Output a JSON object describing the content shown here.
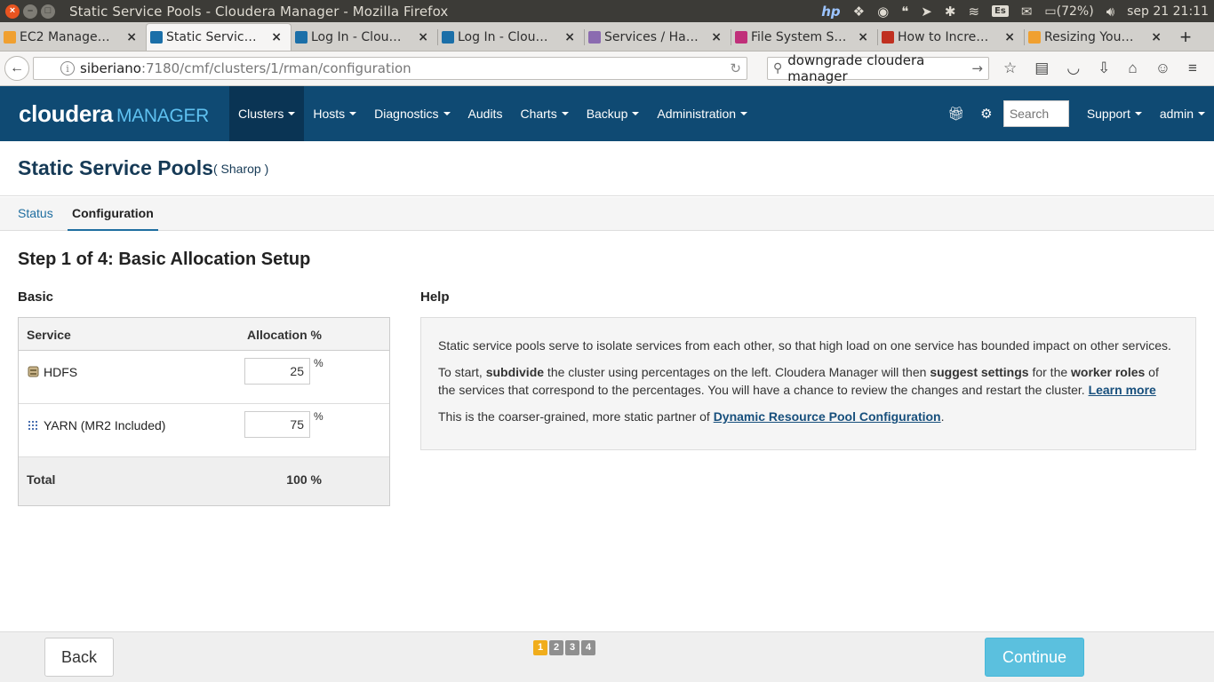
{
  "os": {
    "window_title": "Static Service Pools - Cloudera Manager - Mozilla Firefox",
    "battery": "(72%)",
    "keyboard_layout": "Es",
    "clock": "sep 21 21:11"
  },
  "browser": {
    "tabs": [
      {
        "label": "EC2 Manage…",
        "icon_color": "#f0a030",
        "active": false
      },
      {
        "label": "Static Servic…",
        "icon_color": "#1b6fa8",
        "active": true
      },
      {
        "label": "Log In - Clou…",
        "icon_color": "#1b6fa8",
        "active": false
      },
      {
        "label": "Log In - Clou…",
        "icon_color": "#1b6fa8",
        "active": false
      },
      {
        "label": "Services / Ha…",
        "icon_color": "#8b6bb0",
        "active": false
      },
      {
        "label": "File System S…",
        "icon_color": "#c0307a",
        "active": false
      },
      {
        "label": "How to Incre…",
        "icon_color": "#c03020",
        "active": false
      },
      {
        "label": "Resizing You…",
        "icon_color": "#f0a030",
        "active": false
      }
    ],
    "url_host": "siberiano",
    "url_rest": ":7180/cmf/clusters/1/rman/configuration",
    "search_value": "downgrade cloudera manager"
  },
  "header": {
    "logo_main": "cloudera",
    "logo_sub": "MANAGER",
    "nav": [
      {
        "label": "Clusters",
        "dropdown": true,
        "active": true
      },
      {
        "label": "Hosts",
        "dropdown": true,
        "active": false
      },
      {
        "label": "Diagnostics",
        "dropdown": true,
        "active": false
      },
      {
        "label": "Audits",
        "dropdown": false,
        "active": false
      },
      {
        "label": "Charts",
        "dropdown": true,
        "active": false
      },
      {
        "label": "Backup",
        "dropdown": true,
        "active": false
      },
      {
        "label": "Administration",
        "dropdown": true,
        "active": false
      }
    ],
    "search_placeholder": "Search",
    "support_label": "Support",
    "user_label": "admin"
  },
  "page": {
    "title": "Static Service Pools",
    "cluster": "( Sharop )",
    "tabs": [
      {
        "label": "Status",
        "active": false
      },
      {
        "label": "Configuration",
        "active": true
      }
    ],
    "step_title": "Step 1 of 4: Basic Allocation Setup"
  },
  "basic": {
    "heading": "Basic",
    "col_service": "Service",
    "col_allocation": "Allocation %",
    "rows": [
      {
        "service": "HDFS",
        "value": "25",
        "unit": "%"
      },
      {
        "service": "YARN (MR2 Included)",
        "value": "75",
        "unit": "%"
      }
    ],
    "total_label": "Total",
    "total_value": "100 %"
  },
  "help": {
    "heading": "Help",
    "p1": "Static service pools serve to isolate services from each other, so that high load on one service has bounded impact on other services.",
    "p2_a": "To start, ",
    "p2_b": "subdivide",
    "p2_c": " the cluster using percentages on the left. Cloudera Manager will then ",
    "p2_d": "suggest settings",
    "p2_e": " for the ",
    "p2_f": "worker roles",
    "p2_g": " of the services that correspond to the percentages. You will have a chance to review the changes and restart the cluster. ",
    "p2_link": "Learn more",
    "p3_a": "This is the coarser-grained, more static partner of ",
    "p3_link": "Dynamic Resource Pool Configuration",
    "p3_b": "."
  },
  "footer": {
    "back_label": "Back",
    "steps": [
      "1",
      "2",
      "3",
      "4"
    ],
    "current_step": 1,
    "continue_label": "Continue"
  }
}
